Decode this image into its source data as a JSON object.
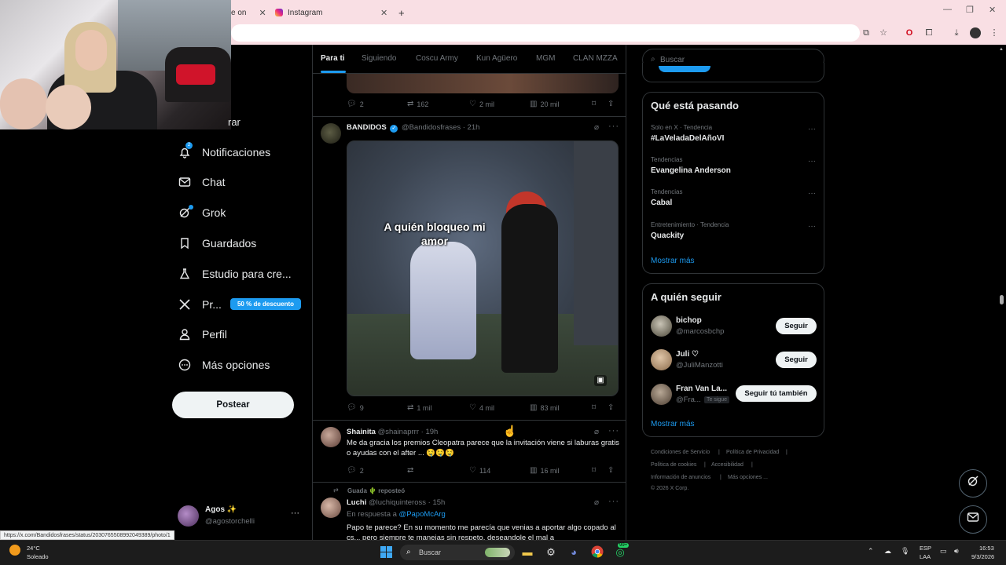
{
  "browser": {
    "tabs": [
      {
        "label": "e on",
        "active": false
      },
      {
        "label": "Instagram",
        "active": false
      }
    ],
    "new_tab": "+",
    "status_url": "https://x.com/Bandidosfrases/status/2030765508992049389/photo/1"
  },
  "nav": {
    "partial_label": "rar",
    "items": [
      {
        "key": "notifications",
        "label": "Notificaciones",
        "icon": "bell-icon",
        "badge": "2"
      },
      {
        "key": "chat",
        "label": "Chat",
        "icon": "mail-icon"
      },
      {
        "key": "grok",
        "label": "Grok",
        "icon": "grok-icon"
      },
      {
        "key": "bookmarks",
        "label": "Guardados",
        "icon": "bookmark-icon"
      },
      {
        "key": "studio",
        "label": "Estudio para cre...",
        "icon": "flask-icon"
      },
      {
        "key": "premium",
        "label": "Pr...",
        "icon": "x-logo-icon"
      },
      {
        "key": "profile",
        "label": "Perfil",
        "icon": "person-icon"
      },
      {
        "key": "more",
        "label": "Más opciones",
        "icon": "more-circle-icon"
      }
    ],
    "premium_badge": "50 % de descuento",
    "post_button": "Postear",
    "account": {
      "name": "Agos ✨",
      "handle": "@agostorchelli",
      "more": "···"
    }
  },
  "feed": {
    "tabs": [
      "Para ti",
      "Siguiendo",
      "Coscu Army",
      "Kun Agüero",
      "MGM",
      "CLAN MZZA"
    ],
    "active_tab": "Para ti",
    "tweets": [
      {
        "stats": {
          "replies": "2",
          "retweets": "162",
          "likes": "2 mil",
          "views": "20 mil"
        }
      },
      {
        "name": "BANDIDOS",
        "verified": true,
        "handle": "@Bandidosfrases",
        "time": "· 21h",
        "media_caption": "A quién bloqueo mi amor",
        "stats": {
          "replies": "9",
          "retweets": "1 mil",
          "likes": "4 mil",
          "views": "83 mil"
        }
      },
      {
        "name": "Shainita",
        "handle": "@shainaprrr",
        "time": "· 19h",
        "text": "Me da gracia los premios Cleopatra parece que la invitación viene si laburas gratis o ayudas con el after ... 🤤🤤🤤",
        "stats": {
          "replies": "2",
          "retweets": "",
          "likes": "114",
          "views": "16 mil"
        }
      },
      {
        "repost_note": "Guada 🌵 reposteó",
        "name": "Luchi",
        "handle": "@luchiquinteross",
        "time": "· 15h",
        "reply_prefix": "En respuesta a",
        "reply_to": "@PapoMcArg",
        "text": "Papo te parece? En su momento me parecía que venias a aportar algo copado al cs... pero siempre te manejas sin respeto, deseandole el mal a"
      }
    ]
  },
  "sidebar": {
    "search_placeholder": "Buscar",
    "trends_title": "Qué está pasando",
    "trends": [
      {
        "context": "Solo en X · Tendencia",
        "name": "#LaVeladaDelAñoVI"
      },
      {
        "context": "Tendencias",
        "name": "Evangelina Anderson"
      },
      {
        "context": "Tendencias",
        "name": "Cabal"
      },
      {
        "context": "Entretenimiento · Tendencia",
        "name": "Quackity"
      }
    ],
    "show_more": "Mostrar más",
    "who_to_follow_title": "A quién seguir",
    "follow": [
      {
        "name": "bichop",
        "handle": "@marcosbchp",
        "button": "Seguir"
      },
      {
        "name": "Juli ♡",
        "handle": "@JuliManzotti",
        "button": "Seguir"
      },
      {
        "name": "Fran Van La...",
        "handle": "@Fra...",
        "follows_you": "Te sigue",
        "button": "Seguir tú también"
      }
    ],
    "footer": [
      "Condiciones de Servicio",
      "Política de Privacidad",
      "Política de cookies",
      "Accesibilidad",
      "Información de anuncios",
      "Más opciones ...",
      "© 2026 X Corp."
    ]
  },
  "taskbar": {
    "weather_temp": "24°C",
    "weather_desc": "Soleado",
    "search_placeholder": "Buscar",
    "lang": "ESP",
    "lang2": "LAA",
    "time": "16:53",
    "date": "9/3/2026",
    "chat_badge": "99+"
  },
  "colors": {
    "accent": "#1d9bf0",
    "bg": "#000000",
    "border": "#2f3336",
    "muted": "#71767b"
  }
}
